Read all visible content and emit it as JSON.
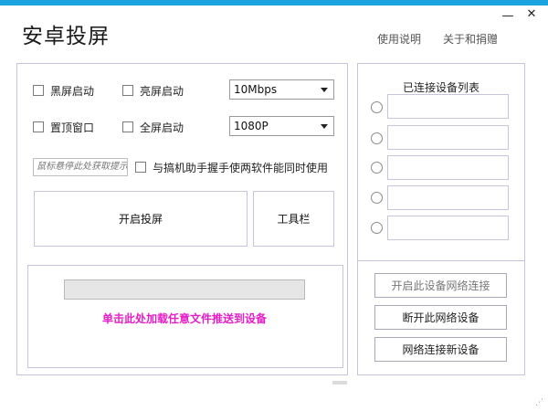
{
  "window": {
    "minimize_label": "—",
    "close_label": "✕"
  },
  "header": {
    "title": "安卓投屏",
    "links": [
      {
        "label": "使用说明"
      },
      {
        "label": "关于和捐赠"
      }
    ]
  },
  "options": {
    "black_screen_start": "黑屏启动",
    "bright_screen_start": "亮屏启动",
    "bitrate": {
      "value": "10Mbps"
    },
    "pin_top_window": "置顶窗口",
    "fullscreen_start": "全屏启动",
    "resolution": {
      "value": "1080P"
    },
    "mouse_hint_text": "鼠标悬停此处获取提示",
    "coexist_label": "与搞机助手握手使两软件能同时使用"
  },
  "actions": {
    "start_cast": "开启投屏",
    "toolbar": "工具栏"
  },
  "push": {
    "progress": 0,
    "label": "单击此处加载任意文件推送到设备"
  },
  "devices": {
    "title": "已连接设备列表",
    "slots": [
      "",
      "",
      "",
      "",
      ""
    ]
  },
  "network": {
    "enable_label": "开启此设备网络连接",
    "disconnect_label": "断开此网络设备",
    "connect_new_label": "网络连接新设备"
  },
  "colors": {
    "accent_bar": "#1aa3dd",
    "push_text": "#e51ec8",
    "border": "#c5c5dc"
  }
}
